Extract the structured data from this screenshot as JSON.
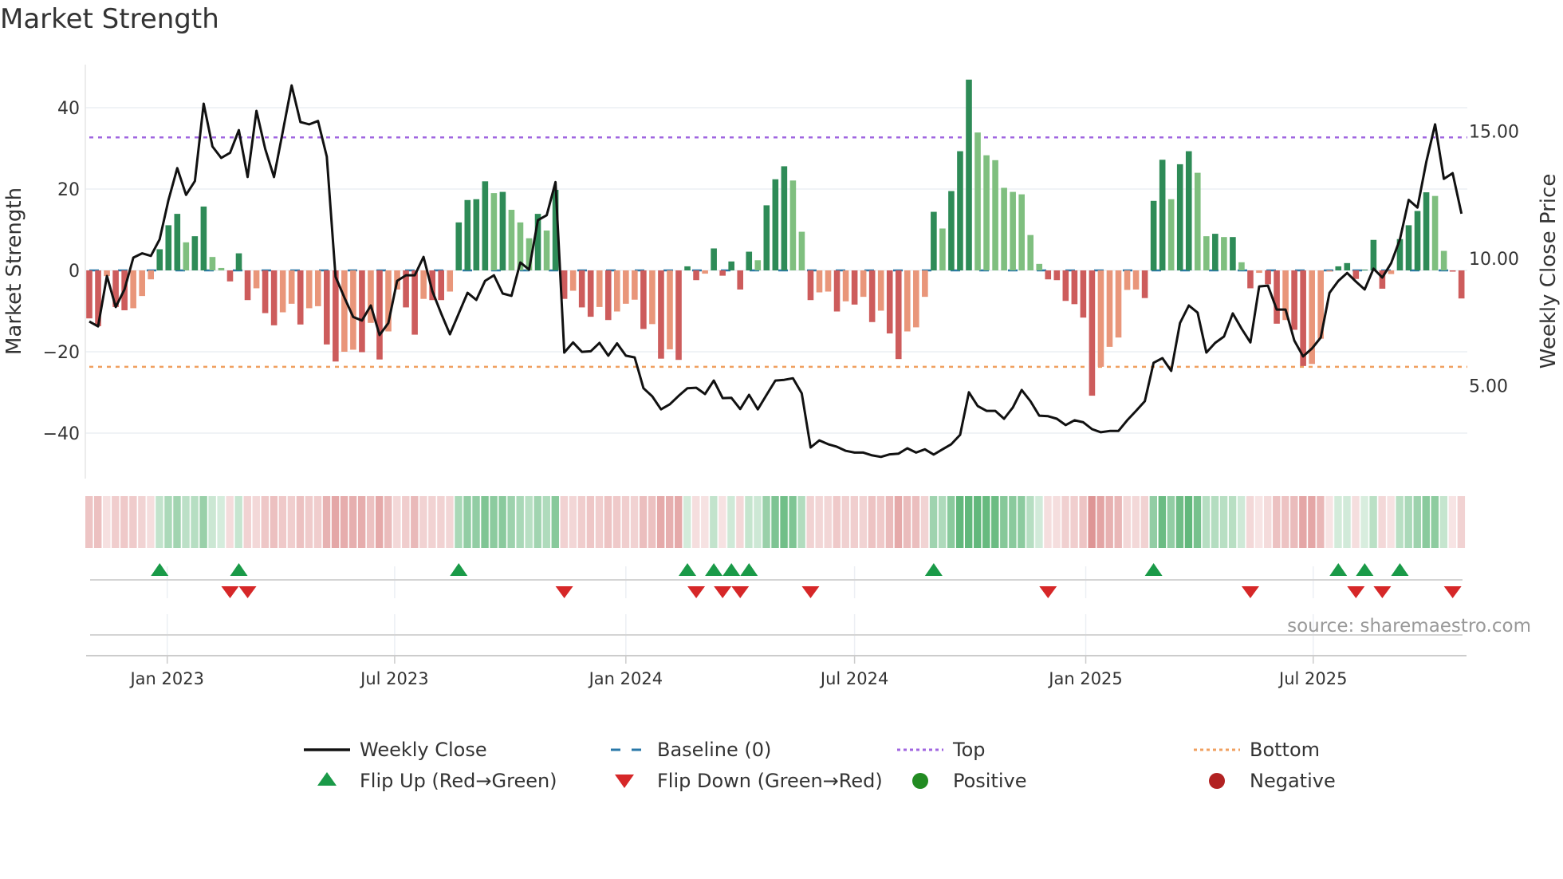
{
  "chart_data": {
    "type": "bar+line",
    "title": "Market Strength",
    "ylabel_left": "Market Strength",
    "ylabel_right": "Weekly Close Price",
    "start_week": "2022-10-31",
    "ylim_left": [
      -50,
      50
    ],
    "yticks_left": [
      40,
      20,
      0,
      -20,
      -40
    ],
    "ytick_labels_left": [
      "40",
      "20",
      "0",
      "−20",
      "−40"
    ],
    "yticks_right": [
      15,
      10,
      5
    ],
    "ytick_labels_right": [
      "15.00",
      "10.00",
      "5.00"
    ],
    "xticks": [
      {
        "date": "2023-01-01",
        "label": "Jan 2023"
      },
      {
        "date": "2023-07-01",
        "label": "Jul 2023"
      },
      {
        "date": "2024-01-01",
        "label": "Jan 2024"
      },
      {
        "date": "2024-07-01",
        "label": "Jul 2024"
      },
      {
        "date": "2025-01-01",
        "label": "Jan 2025"
      },
      {
        "date": "2025-07-01",
        "label": "Jul 2025"
      }
    ],
    "top_level": 32.7,
    "bottom_level": -23.7,
    "baseline": 0,
    "strength": [
      -11.8,
      -13.7,
      -1.4,
      -9,
      -9.8,
      -9.3,
      -6.3,
      -2.2,
      5.2,
      11.1,
      13.9,
      6.9,
      8.4,
      15.7,
      3.3,
      0.6,
      -2.7,
      4.2,
      -7.3,
      -4.4,
      -10.5,
      -13.5,
      -10.3,
      -8.2,
      -13.3,
      -9.3,
      -8.8,
      -18.2,
      -22.4,
      -20,
      -19.5,
      -20.1,
      -12.9,
      -21.9,
      -15,
      -4.7,
      -9.1,
      -15.8,
      -7,
      -7.3,
      -7.3,
      -5.2,
      11.8,
      17.3,
      17.5,
      21.9,
      19,
      19.3,
      14.9,
      11.8,
      7.9,
      13.9,
      9.8,
      19.8,
      -7,
      -5,
      -9.1,
      -11.4,
      -9,
      -12.2,
      -10.1,
      -8.2,
      -7.2,
      -14.4,
      -13.2,
      -21.7,
      -19.4,
      -22,
      1,
      -2.4,
      -0.8,
      5.4,
      -1.3,
      2.2,
      -4.7,
      4.6,
      2.5,
      16,
      22.4,
      25.6,
      22.1,
      9.5,
      -7.3,
      -5.4,
      -5.2,
      -10.1,
      -7.6,
      -8.4,
      -6.5,
      -12.7,
      -9.9,
      -15.5,
      -21.8,
      -15,
      -14,
      -6.5,
      14.4,
      10.3,
      19.5,
      29.3,
      46.9,
      33.9,
      28.3,
      27.1,
      20.3,
      19.3,
      18.7,
      8.7,
      1.6,
      -2.2,
      -2.4,
      -7.5,
      -8.3,
      -11.6,
      -30.8,
      -23.7,
      -18.8,
      -16.5,
      -4.8,
      -4.7,
      -6.8,
      17.1,
      27.2,
      17.5,
      26.1,
      29.3,
      24,
      8.4,
      9,
      8.2,
      8.2,
      2,
      -4.4,
      -0.6,
      -3.4,
      -13.1,
      -12.2,
      -14.6,
      -23.5,
      -23,
      -16.8,
      -0.3,
      1,
      1.8,
      -2.1,
      0.2,
      7.5,
      -4.5,
      -0.9,
      7.7,
      11.1,
      14.6,
      19.2,
      18.3,
      4.8,
      -0.3,
      -6.9
    ],
    "weekly_close": [
      7.52,
      7.33,
      9.31,
      8.09,
      8.78,
      10.03,
      10.2,
      10.1,
      10.75,
      12.3,
      13.55,
      12.5,
      13.04,
      16.08,
      14.4,
      13.95,
      14.15,
      15.04,
      13.2,
      15.8,
      14.3,
      13.2,
      15.0,
      16.8,
      15.36,
      15.27,
      15.4,
      14.0,
      9.28,
      8.46,
      7.7,
      7.56,
      8.15,
      6.99,
      7.46,
      9.12,
      9.34,
      9.34,
      10.06,
      8.71,
      7.84,
      7.02,
      7.84,
      8.65,
      8.37,
      9.12,
      9.34,
      8.62,
      8.53,
      9.84,
      9.56,
      11.5,
      11.7,
      13.0,
      6.3,
      6.7,
      6.33,
      6.35,
      6.68,
      6.18,
      6.66,
      6.18,
      6.11,
      4.9,
      4.58,
      4.07,
      4.27,
      4.6,
      4.9,
      4.92,
      4.67,
      5.2,
      4.51,
      4.52,
      4.08,
      4.64,
      4.07,
      4.64,
      5.2,
      5.23,
      5.29,
      4.7,
      2.57,
      2.85,
      2.7,
      2.6,
      2.44,
      2.37,
      2.37,
      2.26,
      2.2,
      2.3,
      2.33,
      2.54,
      2.37,
      2.5,
      2.29,
      2.5,
      2.7,
      3.07,
      4.74,
      4.2,
      4.01,
      4.01,
      3.7,
      4.14,
      4.83,
      4.39,
      3.82,
      3.8,
      3.7,
      3.45,
      3.64,
      3.56,
      3.29,
      3.17,
      3.22,
      3.22,
      3.64,
      4.01,
      4.39,
      5.9,
      6.08,
      5.58,
      7.46,
      8.15,
      7.87,
      6.3,
      6.68,
      6.93,
      7.84,
      7.24,
      6.7,
      8.9,
      8.93,
      7.99,
      7.99,
      6.77,
      6.15,
      6.46,
      6.89,
      8.65,
      9.12,
      9.43,
      9.09,
      8.78,
      9.6,
      9.25,
      9.81,
      10.75,
      12.3,
      12.0,
      13.8,
      15.27,
      13.13,
      13.35,
      11.76
    ],
    "legend": [
      {
        "label": "Weekly Close",
        "kind": "line",
        "color": "#111111"
      },
      {
        "label": "Baseline (0)",
        "kind": "dash",
        "color": "#2a78a8"
      },
      {
        "label": "Top",
        "kind": "dot",
        "color": "#a066e0"
      },
      {
        "label": "Bottom",
        "kind": "dot",
        "color": "#f0a060"
      },
      {
        "label": "Flip Up (Red→Green)",
        "kind": "tri-up",
        "color": "#1a9a48"
      },
      {
        "label": "Flip Down (Green→Red)",
        "kind": "tri-down",
        "color": "#d62728"
      },
      {
        "label": "Positive",
        "kind": "dot-marker",
        "color": "#228b22"
      },
      {
        "label": "Negative",
        "kind": "dot-marker",
        "color": "#b22222"
      }
    ],
    "legend_placement": "bottom",
    "source": "source: sharemaestro.com"
  },
  "colors": {
    "pos_rising": "#2e8b57",
    "pos_falling": "#7fbf7f",
    "neg_falling": "#cd5c5c",
    "neg_rising": "#e9967a",
    "grid": "#eceff4"
  }
}
